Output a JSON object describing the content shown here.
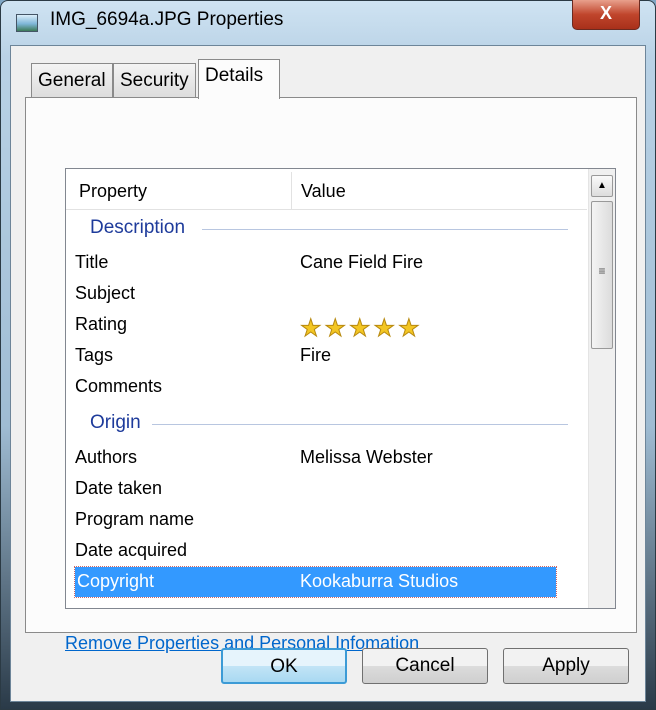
{
  "window": {
    "title": "IMG_6694a.JPG Properties",
    "close_label": "X"
  },
  "tabs": [
    {
      "label": "General"
    },
    {
      "label": "Security"
    },
    {
      "label": "Details"
    }
  ],
  "list": {
    "headers": {
      "property": "Property",
      "value": "Value"
    },
    "groups": {
      "description": "Description",
      "origin": "Origin"
    },
    "rows": [
      {
        "property": "Title",
        "value": "Cane Field Fire"
      },
      {
        "property": "Subject",
        "value": ""
      },
      {
        "property": "Rating",
        "value": ""
      },
      {
        "property": "Tags",
        "value": "Fire"
      },
      {
        "property": "Comments",
        "value": ""
      },
      {
        "property": "Authors",
        "value": "Melissa Webster"
      },
      {
        "property": "Date taken",
        "value": ""
      },
      {
        "property": "Program name",
        "value": ""
      },
      {
        "property": "Date acquired",
        "value": ""
      },
      {
        "property": "Copyright",
        "value": "Kookaburra Studios"
      }
    ],
    "rating_stars": "★★★★★",
    "rating_value": 5
  },
  "link": "Remove Properties and Personal Infomation",
  "buttons": {
    "ok": "OK",
    "cancel": "Cancel",
    "apply": "Apply"
  }
}
